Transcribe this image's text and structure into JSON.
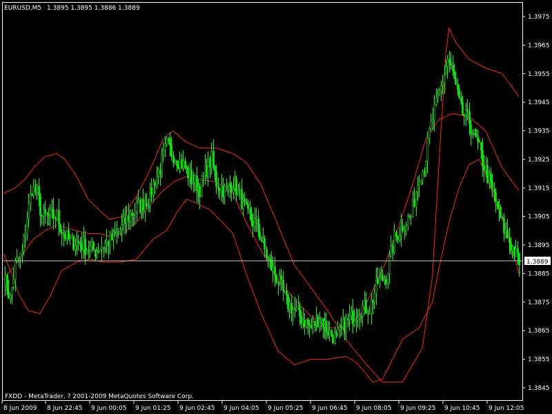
{
  "window": {
    "title": "EURUSD,M5",
    "ohlc": "1.3895 1.3895 1.3886 1.3889",
    "footer": "FXDD - MetaTrader, ? 2001-2009 MetaQuotes Software Corp."
  },
  "colors": {
    "background": "#000000",
    "frame": "#ffffff",
    "candle": "#00ff00",
    "band": "#ff2a00",
    "price_line": "#c8c8c8"
  },
  "chart_data": {
    "type": "candlestick",
    "symbol": "EURUSD",
    "timeframe": "M5",
    "current_price": "1.3889",
    "y_ticks": [
      "1.3975",
      "1.3965",
      "1.3955",
      "1.3945",
      "1.3935",
      "1.3925",
      "1.3915",
      "1.3905",
      "1.3895",
      "1.3885",
      "1.3875",
      "1.3865",
      "1.3855",
      "1.3845"
    ],
    "x_ticks": [
      "8 Jun 2009",
      "8 Jun 22:45",
      "9 Jun 00:05",
      "9 Jun 01:25",
      "9 Jun 02:45",
      "9 Jun 04:05",
      "9 Jun 05:25",
      "9 Jun 06:45",
      "9 Jun 08:05",
      "9 Jun 09:25",
      "9 Jun 10:45",
      "9 Jun 12:05"
    ],
    "ylim": [
      1.3842,
      1.3978
    ],
    "grid": false,
    "bands": {
      "upper": [
        [
          0,
          1.3913
        ],
        [
          7,
          1.3915
        ],
        [
          13,
          1.3918
        ],
        [
          18,
          1.3922
        ],
        [
          25,
          1.3926
        ],
        [
          32,
          1.3927
        ],
        [
          37,
          1.3925
        ],
        [
          44,
          1.3919
        ],
        [
          51,
          1.3911
        ],
        [
          58,
          1.3907
        ],
        [
          64,
          1.3904
        ],
        [
          72,
          1.3905
        ],
        [
          80,
          1.3912
        ],
        [
          88,
          1.3921
        ],
        [
          96,
          1.3932
        ],
        [
          102,
          1.3935
        ],
        [
          110,
          1.3931
        ],
        [
          118,
          1.3929
        ],
        [
          128,
          1.3929
        ],
        [
          138,
          1.3927
        ],
        [
          146,
          1.3924
        ],
        [
          155,
          1.3916
        ],
        [
          165,
          1.3902
        ],
        [
          175,
          1.3888
        ],
        [
          185,
          1.388
        ],
        [
          195,
          1.3872
        ],
        [
          206,
          1.3862
        ],
        [
          217,
          1.3854
        ],
        [
          228,
          1.3847
        ],
        [
          240,
          1.3847
        ],
        [
          252,
          1.3859
        ],
        [
          258,
          1.3884
        ],
        [
          262,
          1.3924
        ],
        [
          266,
          1.3962
        ],
        [
          268,
          1.3971
        ],
        [
          272,
          1.3966
        ],
        [
          280,
          1.396
        ],
        [
          290,
          1.3957
        ],
        [
          300,
          1.3955
        ],
        [
          310,
          1.3947
        ]
      ],
      "middle": [
        [
          0,
          1.3883
        ],
        [
          7,
          1.3888
        ],
        [
          13,
          1.3893
        ],
        [
          18,
          1.3897
        ],
        [
          25,
          1.39
        ],
        [
          32,
          1.3902
        ],
        [
          44,
          1.39
        ],
        [
          51,
          1.3899
        ],
        [
          58,
          1.3899
        ],
        [
          64,
          1.3898
        ],
        [
          72,
          1.3899
        ],
        [
          80,
          1.3903
        ],
        [
          88,
          1.3909
        ],
        [
          96,
          1.3914
        ],
        [
          102,
          1.3917
        ],
        [
          110,
          1.3919
        ],
        [
          118,
          1.3918
        ],
        [
          128,
          1.3917
        ],
        [
          138,
          1.3913
        ],
        [
          146,
          1.3903
        ],
        [
          155,
          1.3893
        ],
        [
          165,
          1.3883
        ],
        [
          175,
          1.3876
        ],
        [
          185,
          1.387
        ],
        [
          195,
          1.3866
        ],
        [
          206,
          1.3866
        ],
        [
          215,
          1.3871
        ],
        [
          222,
          1.3879
        ],
        [
          230,
          1.3889
        ],
        [
          238,
          1.3902
        ],
        [
          246,
          1.3916
        ],
        [
          254,
          1.3932
        ],
        [
          262,
          1.3939
        ],
        [
          270,
          1.3941
        ],
        [
          280,
          1.394
        ],
        [
          290,
          1.3935
        ],
        [
          300,
          1.3922
        ],
        [
          310,
          1.3914
        ]
      ],
      "lower": [
        [
          0,
          1.3892
        ],
        [
          5,
          1.3885
        ],
        [
          9,
          1.3878
        ],
        [
          15,
          1.3872
        ],
        [
          22,
          1.3871
        ],
        [
          28,
          1.3877
        ],
        [
          35,
          1.3886
        ],
        [
          44,
          1.3889
        ],
        [
          52,
          1.389
        ],
        [
          60,
          1.3889
        ],
        [
          70,
          1.3889
        ],
        [
          80,
          1.389
        ],
        [
          90,
          1.3897
        ],
        [
          98,
          1.39
        ],
        [
          105,
          1.3907
        ],
        [
          110,
          1.3911
        ],
        [
          115,
          1.391
        ],
        [
          125,
          1.3907
        ],
        [
          138,
          1.3899
        ],
        [
          146,
          1.3885
        ],
        [
          155,
          1.3871
        ],
        [
          165,
          1.3858
        ],
        [
          175,
          1.3853
        ],
        [
          185,
          1.3855
        ],
        [
          195,
          1.3855
        ],
        [
          206,
          1.3856
        ],
        [
          212,
          1.3854
        ],
        [
          218,
          1.385
        ],
        [
          222,
          1.3847
        ],
        [
          228,
          1.3848
        ],
        [
          240,
          1.3862
        ],
        [
          250,
          1.3866
        ],
        [
          258,
          1.3875
        ],
        [
          262,
          1.3887
        ],
        [
          268,
          1.3903
        ],
        [
          274,
          1.3915
        ],
        [
          280,
          1.3923
        ],
        [
          286,
          1.3925
        ],
        [
          290,
          1.392
        ],
        [
          296,
          1.391
        ],
        [
          304,
          1.3898
        ],
        [
          310,
          1.3885
        ]
      ]
    },
    "close_path": [
      [
        0,
        1.3884
      ],
      [
        4,
        1.3876
      ],
      [
        7,
        1.3888
      ],
      [
        11,
        1.3892
      ],
      [
        14,
        1.3905
      ],
      [
        17,
        1.3915
      ],
      [
        20,
        1.3913
      ],
      [
        23,
        1.3905
      ],
      [
        27,
        1.3905
      ],
      [
        32,
        1.3905
      ],
      [
        35,
        1.39
      ],
      [
        40,
        1.3896
      ],
      [
        45,
        1.3896
      ],
      [
        50,
        1.3894
      ],
      [
        55,
        1.3893
      ],
      [
        60,
        1.3895
      ],
      [
        65,
        1.3897
      ],
      [
        70,
        1.39
      ],
      [
        75,
        1.3905
      ],
      [
        80,
        1.3908
      ],
      [
        85,
        1.391
      ],
      [
        88,
        1.3912
      ],
      [
        91,
        1.3918
      ],
      [
        94,
        1.3922
      ],
      [
        98,
        1.393
      ],
      [
        103,
        1.3926
      ],
      [
        108,
        1.3923
      ],
      [
        113,
        1.3918
      ],
      [
        118,
        1.3915
      ],
      [
        122,
        1.3922
      ],
      [
        125,
        1.3925
      ],
      [
        128,
        1.3917
      ],
      [
        133,
        1.3914
      ],
      [
        138,
        1.3917
      ],
      [
        142,
        1.3912
      ],
      [
        147,
        1.3905
      ],
      [
        152,
        1.3902
      ],
      [
        156,
        1.3895
      ],
      [
        160,
        1.3888
      ],
      [
        165,
        1.3883
      ],
      [
        170,
        1.3875
      ],
      [
        175,
        1.3872
      ],
      [
        180,
        1.3869
      ],
      [
        185,
        1.3866
      ],
      [
        190,
        1.387
      ],
      [
        195,
        1.3865
      ],
      [
        200,
        1.3862
      ],
      [
        205,
        1.3867
      ],
      [
        210,
        1.387
      ],
      [
        215,
        1.3873
      ],
      [
        220,
        1.3873
      ],
      [
        225,
        1.3882
      ],
      [
        230,
        1.3884
      ],
      [
        235,
        1.3897
      ],
      [
        240,
        1.3902
      ],
      [
        245,
        1.3905
      ],
      [
        250,
        1.392
      ],
      [
        253,
        1.3922
      ],
      [
        256,
        1.3934
      ],
      [
        259,
        1.3942
      ],
      [
        262,
        1.3948
      ],
      [
        265,
        1.3955
      ],
      [
        267,
        1.396
      ],
      [
        270,
        1.3955
      ],
      [
        275,
        1.3942
      ],
      [
        280,
        1.3938
      ],
      [
        285,
        1.393
      ],
      [
        290,
        1.3921
      ],
      [
        295,
        1.3912
      ],
      [
        300,
        1.3902
      ],
      [
        305,
        1.3895
      ],
      [
        310,
        1.3889
      ]
    ]
  }
}
